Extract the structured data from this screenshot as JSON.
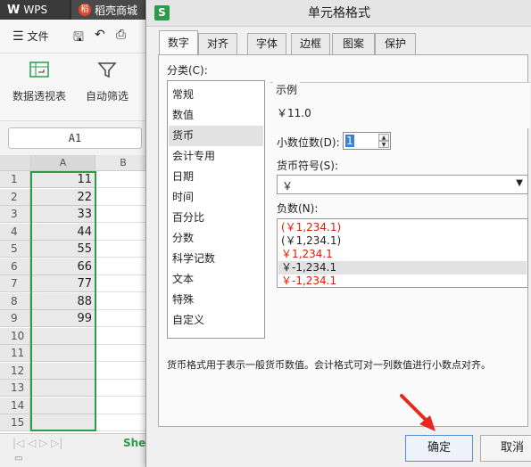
{
  "app_tabs": [
    {
      "label": "WPS"
    },
    {
      "label": "稻壳商城"
    }
  ],
  "menu": {
    "file_label": "文件"
  },
  "ribbon": {
    "pivot_label": "数据透视表",
    "filter_label": "自动筛选"
  },
  "name_box": "A1",
  "columns": [
    "A",
    "B"
  ],
  "rows": [
    "1",
    "2",
    "3",
    "4",
    "5",
    "6",
    "7",
    "8",
    "9",
    "10",
    "11",
    "12",
    "13",
    "14",
    "15"
  ],
  "cells": [
    "11",
    "22",
    "33",
    "44",
    "55",
    "66",
    "77",
    "88",
    "99",
    "",
    "",
    "",
    "",
    "",
    ""
  ],
  "sheet_tab": "Shee",
  "dialog": {
    "title": "单元格格式",
    "tabs": [
      "数字",
      "对齐",
      "字体",
      "边框",
      "图案",
      "保护"
    ],
    "category_label": "分类(C):",
    "categories": [
      "常规",
      "数值",
      "货币",
      "会计专用",
      "日期",
      "时间",
      "百分比",
      "分数",
      "科学记数",
      "文本",
      "特殊",
      "自定义"
    ],
    "selected_category": "货币",
    "sample_label": "示例",
    "sample_value": "￥11.0",
    "decimal_label": "小数位数(D):",
    "decimal_value": "1",
    "symbol_label": "货币符号(S):",
    "symbol_value": "￥",
    "negative_label": "负数(N):",
    "negatives": [
      "(￥1,234.1)",
      "(￥1,234.1)",
      "￥1,234.1",
      "￥-1,234.1",
      "￥-1,234.1"
    ],
    "description": "货币格式用于表示一般货币数值。会计格式可对一列数值进行小数点对齐。",
    "ok_label": "确定",
    "cancel_label": "取消"
  },
  "colors": {
    "accent": "#2e9a4c",
    "negative_red": "#d81e06",
    "selection_blue": "#3d7fd6"
  }
}
